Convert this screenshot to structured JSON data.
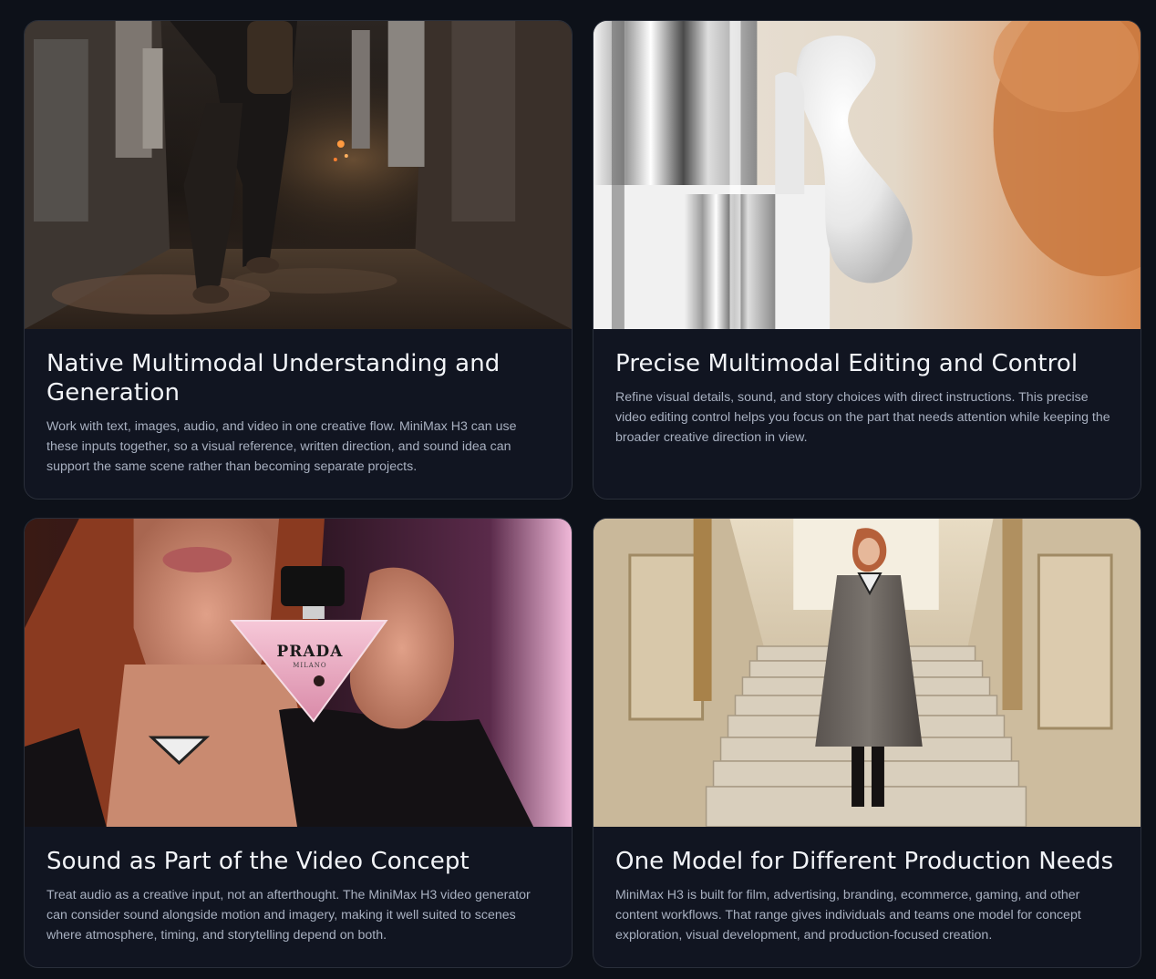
{
  "features": [
    {
      "title": "Native Multimodal Understanding and Generation",
      "description": "Work with text, images, audio, and video in one creative flow. MiniMax H3 can use these inputs together, so a visual reference, written direction, and sound idea can support the same scene rather than becoming separate projects."
    },
    {
      "title": "Precise Multimodal Editing and Control",
      "description": "Refine visual details, sound, and story choices with direct instructions. This precise video editing control helps you focus on the part that needs attention while keeping the broader creative direction in view."
    },
    {
      "title": "Sound as Part of the Video Concept",
      "description": "Treat audio as a creative input, not an afterthought. The MiniMax H3 video generator can consider sound alongside motion and imagery, making it well suited to scenes where atmosphere, timing, and storytelling depend on both."
    },
    {
      "title": "One Model for Different Production Needs",
      "description": "MiniMax H3 is built for film, advertising, branding, ecommerce, gaming, and other content workflows. That range gives individuals and teams one model for concept exploration, visual development, and production-focused creation."
    }
  ],
  "bottle_label": {
    "brand": "PRADA",
    "city": "MILANO"
  },
  "colors": {
    "page_background": "#0d1119",
    "card_background": "#111521",
    "card_border": "#2a2f3a",
    "title_text": "#f2f4f8",
    "body_text": "#a8b0c0"
  }
}
